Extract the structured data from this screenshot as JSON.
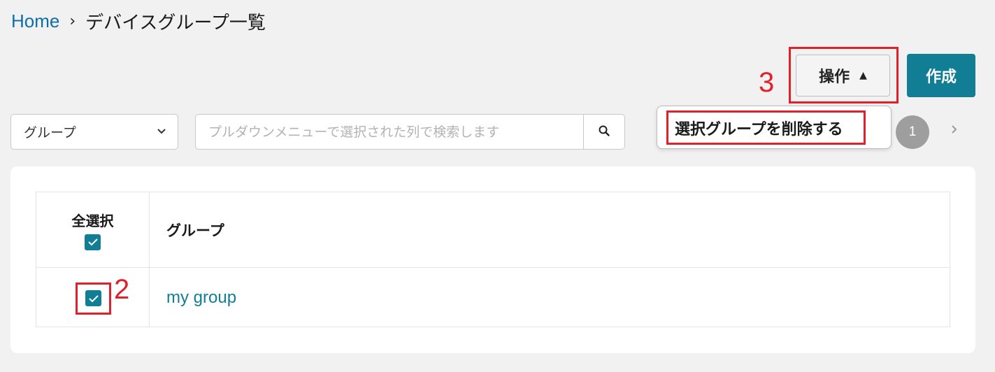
{
  "breadcrumb": {
    "home": "Home",
    "separator": "›",
    "current": "デバイスグループ一覧"
  },
  "toolbar": {
    "operations_label": "操作",
    "operations_caret": "▲",
    "create_label": "作成"
  },
  "dropdown": {
    "items": [
      {
        "label": "選択グループを削除する"
      }
    ]
  },
  "filter": {
    "column_select": {
      "selected": "グループ"
    },
    "search": {
      "placeholder": "プルダウンメニューで選択された列で検索します",
      "value": ""
    }
  },
  "pagination": {
    "current_page": "1",
    "next_icon": "chevron-right-icon"
  },
  "table": {
    "columns": {
      "select_all": "全選択",
      "group": "グループ"
    },
    "rows": [
      {
        "name": "my group",
        "checked": true
      }
    ],
    "select_all_checked": true
  },
  "annotations": {
    "step_2": "2",
    "step_3": "3"
  },
  "colors": {
    "accent": "#127e95",
    "link": "#0e6fa8",
    "annotation": "#e0202a",
    "background": "#f1f1f1"
  }
}
